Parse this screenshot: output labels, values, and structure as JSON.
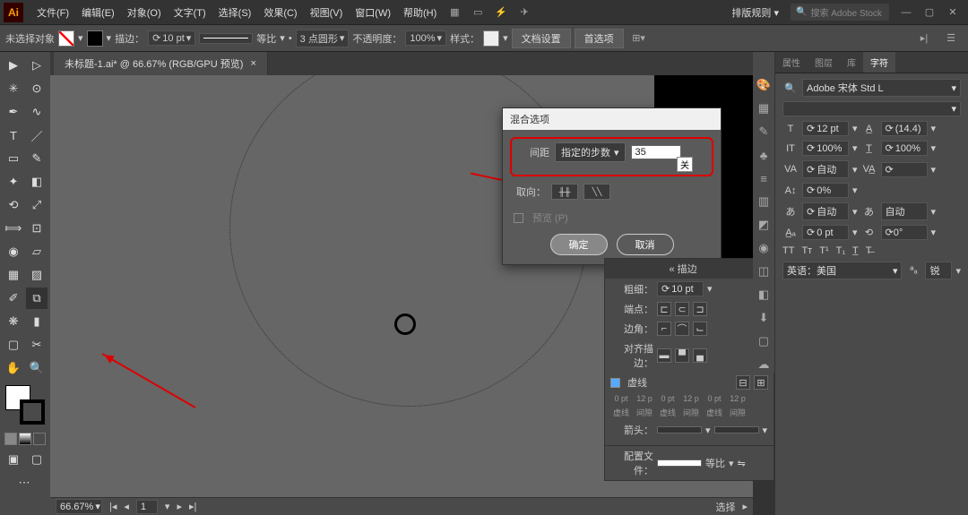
{
  "app": {
    "logo": "Ai"
  },
  "menubar": {
    "items": [
      "文件(F)",
      "编辑(E)",
      "对象(O)",
      "文字(T)",
      "选择(S)",
      "效果(C)",
      "视图(V)",
      "窗口(W)",
      "帮助(H)"
    ],
    "layout": "排版规则",
    "search": "搜索 Adobe Stock"
  },
  "controlbar": {
    "noSelection": "未选择对象",
    "strokeLabel": "描边：",
    "strokeWidth": "10 pt",
    "uniform": "等比",
    "profile": "3 点圆形",
    "opacityLabel": "不透明度：",
    "opacity": "100%",
    "styleLabel": "样式：",
    "docSetup": "文档设置",
    "prefs": "首选项"
  },
  "docTab": {
    "name": "未标题-1.ai* @ 66.67% (RGB/GPU 预览)",
    "close": "×"
  },
  "dialog": {
    "title": "混合选项",
    "spacingLabel": "间距",
    "spacingMode": "指定的步数",
    "spacingValue": "35",
    "orientLabel": "取向：",
    "previewLabel": "预览 (P)",
    "ok": "确定",
    "cancel": "取消",
    "tag": "关"
  },
  "strokePanel": {
    "title": "描边",
    "weightLabel": "粗细：",
    "weight": "10 pt",
    "capLabel": "端点：",
    "cornerLabel": "边角：",
    "alignLabel": "对齐描边：",
    "dashedLabel": "虚线",
    "dashHeaders": [
      "0 pt",
      "12 p",
      "0 pt",
      "12 p",
      "0 pt",
      "12 p"
    ],
    "dashLabels": [
      "虚线",
      "间隙",
      "虚线",
      "间隙",
      "虚线",
      "间隙"
    ],
    "arrowLabel": "箭头：",
    "profileLabel": "配置文件：",
    "profile": "等比"
  },
  "charPanel": {
    "tabs": [
      "属性",
      "图层",
      "库",
      "字符"
    ],
    "font": "Adobe 宋体 Std L",
    "size": "12 pt",
    "leading": "(14.4)",
    "tracking": "100%",
    "kerning": "100%",
    "vscale": "自动",
    "hscale": "0%",
    "baseline": "自动",
    "rotate": "0 pt",
    "lang": "英语：美国",
    "aa": "锐"
  },
  "status": {
    "zoom": "66.67%",
    "nav": "选择"
  }
}
